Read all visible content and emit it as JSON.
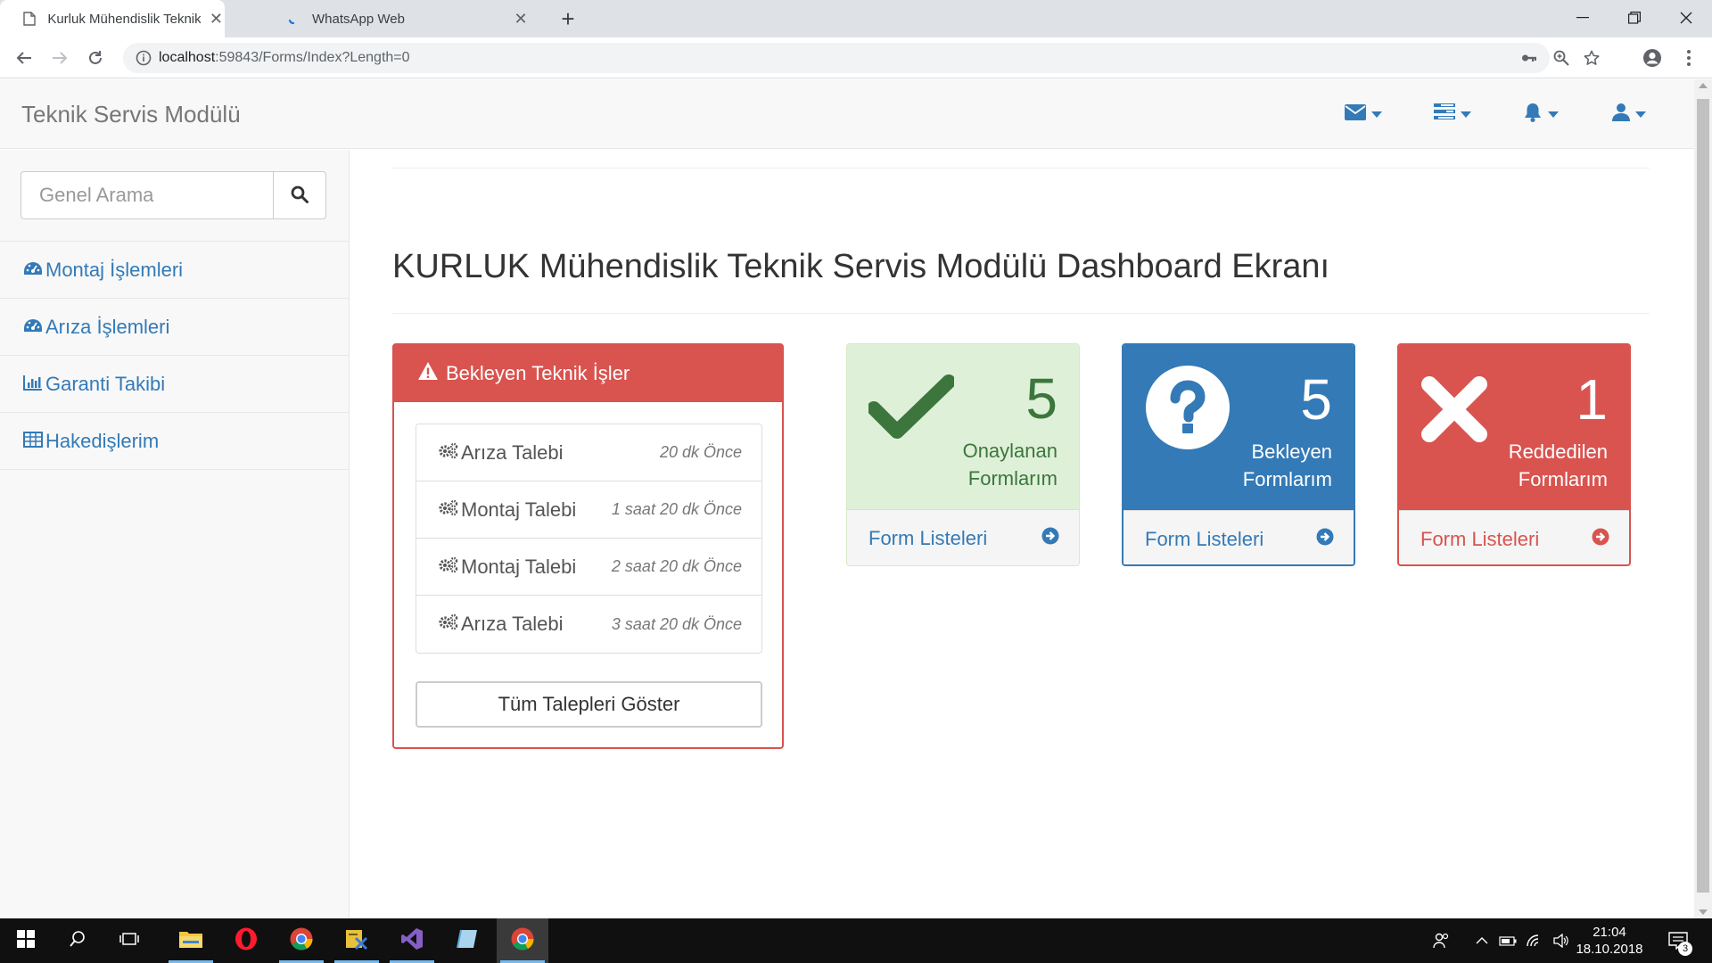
{
  "browser": {
    "tabs": [
      {
        "title": "Kurluk Mühendislik Teknik Servis",
        "active": true,
        "close": "✕"
      },
      {
        "title": "WhatsApp Web",
        "active": false,
        "close": "✕"
      }
    ],
    "new_tab": "+",
    "url_host": "localhost",
    "url_path": ":59843/Forms/Index?Length=0",
    "icons": [
      "back-icon",
      "forward-icon",
      "reload-icon",
      "info-icon",
      "key-icon",
      "zoom-icon",
      "star-icon",
      "profile-icon",
      "menu-icon",
      "minimize-icon",
      "maximize-icon",
      "close-icon"
    ]
  },
  "app": {
    "brand": "Teknik Servis Modülü",
    "nav_icons": [
      "envelope-icon",
      "tasks-icon",
      "bell-icon",
      "user-icon"
    ],
    "accent": "#337ab7",
    "danger": "#d9534f",
    "success": "#3c763d"
  },
  "sidebar": {
    "search": {
      "placeholder": "Genel Arama",
      "value": ""
    },
    "items": [
      {
        "label": "Montaj İşlemleri",
        "icon": "dashboard-icon"
      },
      {
        "label": "Arıza İşlemleri",
        "icon": "dashboard-icon"
      },
      {
        "label": "Garanti Takibi",
        "icon": "bar-chart-icon"
      },
      {
        "label": "Hakedişlerim",
        "icon": "table-icon"
      }
    ]
  },
  "main": {
    "title": "KURLUK Mühendislik Teknik Servis Modülü Dashboard Ekranı",
    "tasks_panel": {
      "heading": "Bekleyen Teknik İşler",
      "items": [
        {
          "label": "Arıza Talebi",
          "time": "20 dk Önce"
        },
        {
          "label": "Montaj Talebi",
          "time": "1 saat 20 dk Önce"
        },
        {
          "label": "Montaj Talebi",
          "time": "2 saat 20 dk Önce"
        },
        {
          "label": "Arıza Talebi",
          "time": "3 saat 20 dk Önce"
        }
      ],
      "show_all": "Tüm Talepleri Göster"
    },
    "cards": [
      {
        "count": "5",
        "label_line1": "Onaylanan",
        "label_line2": "Formlarım",
        "footer": "Form Listeleri",
        "icon": "check-icon"
      },
      {
        "count": "5",
        "label_line1": "Bekleyen",
        "label_line2": "Formlarım",
        "footer": "Form Listeleri",
        "icon": "question-icon"
      },
      {
        "count": "1",
        "label_line1": "Reddedilen",
        "label_line2": "Formlarım",
        "footer": "Form Listeleri",
        "icon": "times-icon"
      }
    ]
  },
  "taskbar": {
    "time": "21:04",
    "date": "18.10.2018",
    "notification_count": "3"
  }
}
